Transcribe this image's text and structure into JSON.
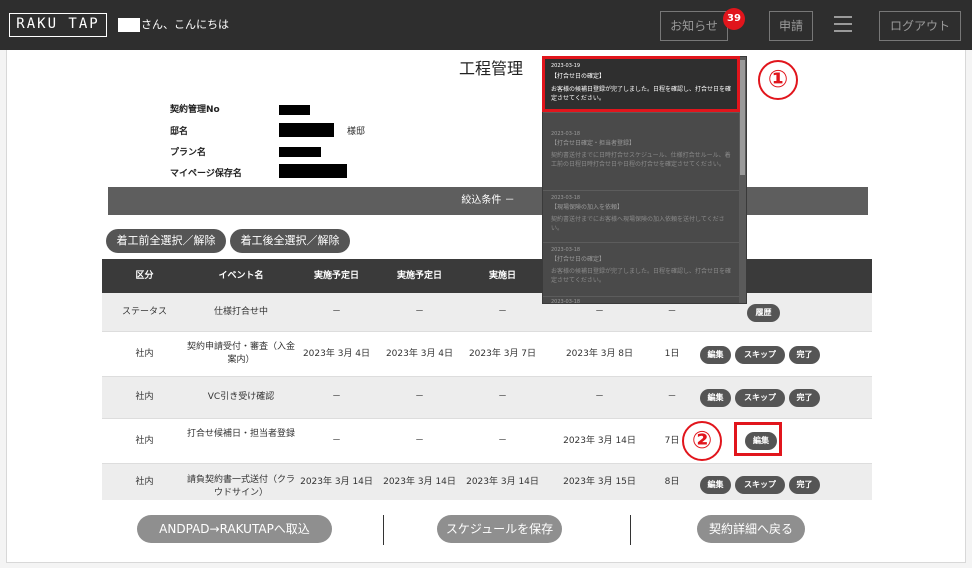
{
  "header": {
    "logo": "RAKU TAP",
    "greeting": "さん、こんにちは",
    "notice_label": "お知らせ",
    "notice_count": "39",
    "apply_label": "申請",
    "menu_icon": "hamburger-menu-icon",
    "logout_label": "ログアウト"
  },
  "page": {
    "title": "工程管理",
    "info": {
      "contract_no_label": "契約管理No",
      "name_label": "邸名",
      "name_suffix": "様邸",
      "plan_label": "プラン名",
      "mypage_label": "マイページ保存名"
    },
    "filter_label": "絞込条件 －",
    "select_before_label": "着工前全選択／解除",
    "select_after_label": "着工後全選択／解除"
  },
  "table": {
    "headers": [
      "区分",
      "イベント名",
      "実施予定日",
      "実施予定日",
      "実施日"
    ],
    "rows": [
      {
        "category": "ステータス",
        "event": "仕様打合せ中",
        "d1": "－",
        "d2": "－",
        "d3": "－",
        "d4": "－",
        "days": "－",
        "buttons": [
          "履歴"
        ]
      },
      {
        "category": "社内",
        "event": "契約申請受付・審査（入金案内）",
        "d1": "2023年 3月 4日",
        "d2": "2023年 3月 4日",
        "d3": "2023年 3月 7日",
        "d4": "2023年 3月 8日",
        "days": "1日",
        "buttons": [
          "編集",
          "スキップ",
          "完了"
        ]
      },
      {
        "category": "社内",
        "event": "VC引き受け確認",
        "d1": "－",
        "d2": "－",
        "d3": "－",
        "d4": "－",
        "days": "－",
        "buttons": [
          "編集",
          "スキップ",
          "完了"
        ]
      },
      {
        "category": "社内",
        "event": "打合せ候補日・担当者登録",
        "d1": "－",
        "d2": "－",
        "d3": "－",
        "d4": "2023年 3月 14日",
        "days": "7日",
        "buttons": [
          "編集"
        ]
      },
      {
        "category": "社内",
        "event": "請負契約書一式送付（クラウドサイン）",
        "d1": "2023年 3月 14日",
        "d2": "2023年 3月 14日",
        "d3": "2023年 3月 14日",
        "d4": "2023年 3月 15日",
        "days": "8日",
        "buttons": [
          "編集",
          "スキップ",
          "完了"
        ]
      }
    ]
  },
  "footer": {
    "import_label": "ANDPAD→RAKUTAPへ取込",
    "save_label": "スケジュールを保存",
    "back_label": "契約詳細へ戻る"
  },
  "notifications": [
    {
      "date": "2023-03-19",
      "title": "【打合せ日の確定】",
      "body": "お客様の候補日登録が完了しました。日程を確認し、打合せ日を確定させてください。"
    },
    {
      "date": "2023-03-18",
      "title": "【打合せ日確定・担当者登録】",
      "body": "契約書送付までに日時打合せスケジュール、仕様打合せルール、着工前の日程日時打合せ日や日程の打合せを確定させてください。"
    },
    {
      "date": "2023-03-18",
      "title": "【現場保険の加入を依頼】",
      "body": "契約書送付までにお客様へ現場保険の加入依頼を送付してください。"
    },
    {
      "date": "2023-03-18",
      "title": "【打合せ日の確定】",
      "body": "お客様の候補日登録が完了しました。日程を確認し、打合せ日を確定させてください。"
    },
    {
      "date": "2023-03-18",
      "title": "",
      "body": ""
    }
  ],
  "annotations": {
    "marker1": "①",
    "marker2": "②",
    "color": "#e1151c"
  }
}
